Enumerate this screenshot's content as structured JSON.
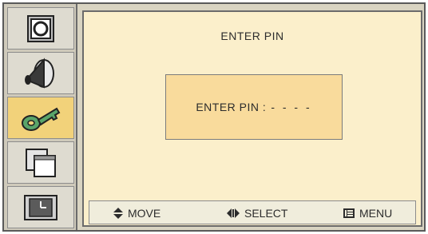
{
  "sidebar": {
    "items": [
      {
        "icon": "picture-frame-icon"
      },
      {
        "icon": "speaker-cone-icon"
      },
      {
        "icon": "key-icon",
        "active": true
      },
      {
        "icon": "windows-overlap-icon"
      },
      {
        "icon": "clock-panel-icon"
      }
    ]
  },
  "main": {
    "title": "ENTER PIN",
    "pin_prompt": "ENTER PIN :",
    "pin_value": "- - - -"
  },
  "footer": {
    "move_label": "MOVE",
    "select_label": "SELECT",
    "menu_label": "MENU"
  },
  "colors": {
    "main_bg": "#fbefcb",
    "pin_box_bg": "#f9db9c",
    "active_item_bg": "#f2d27a"
  }
}
